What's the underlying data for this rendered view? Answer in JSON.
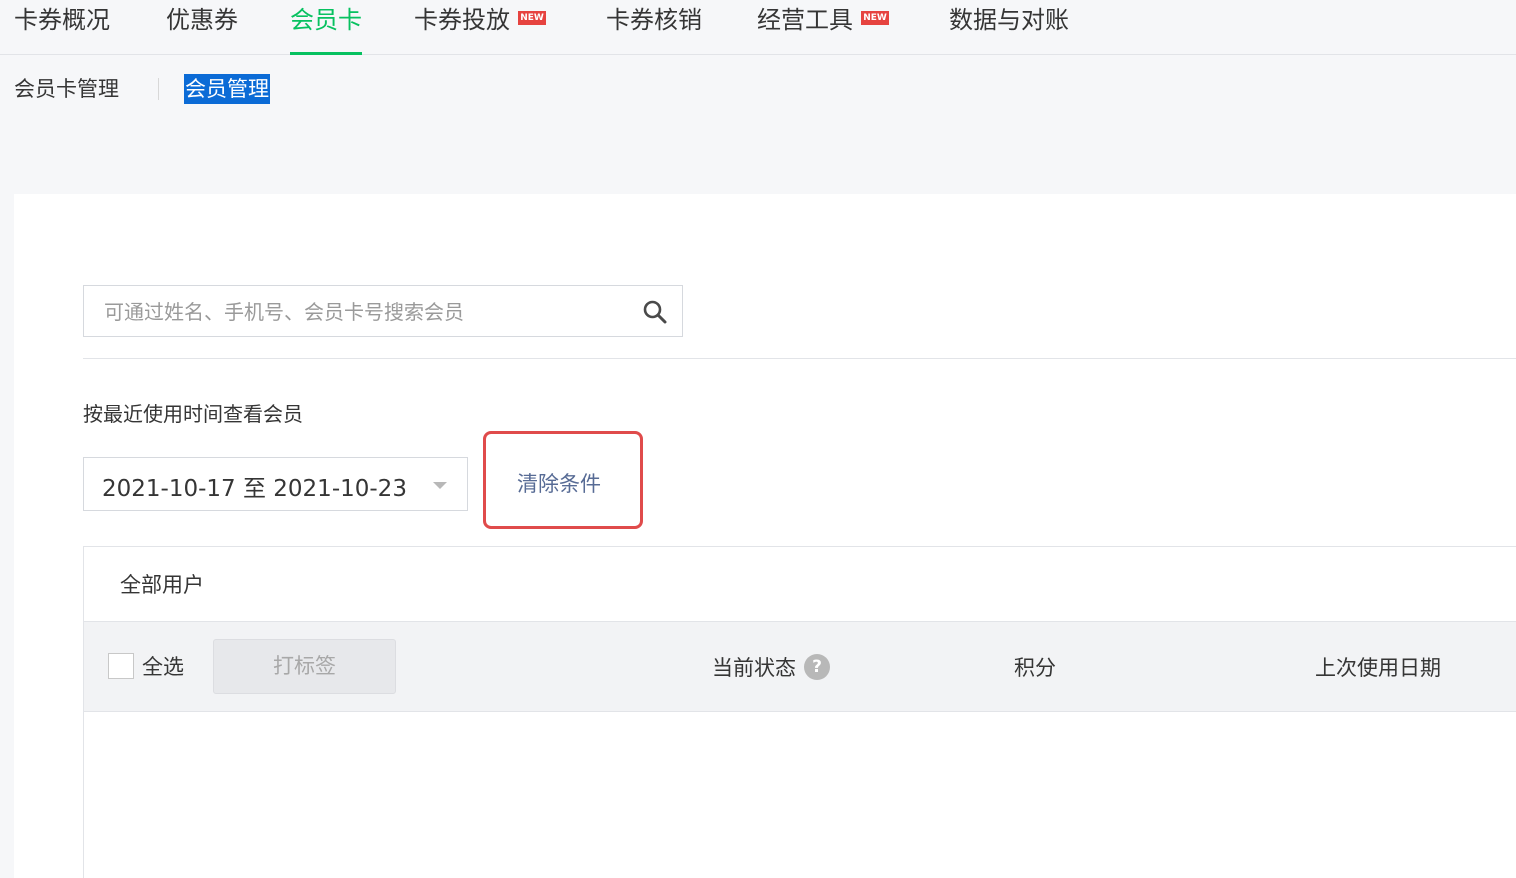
{
  "nav": {
    "items": [
      {
        "label": "卡券概况"
      },
      {
        "label": "优惠券"
      },
      {
        "label": "会员卡"
      },
      {
        "label": "卡券投放",
        "badge": "NEW"
      },
      {
        "label": "卡券核销"
      },
      {
        "label": "经营工具",
        "badge": "NEW"
      },
      {
        "label": "数据与对账"
      }
    ],
    "active_index": 2,
    "accent": "#07c160"
  },
  "subnav": {
    "items": [
      "会员卡管理",
      "会员管理"
    ],
    "selected": "会员管理"
  },
  "search": {
    "placeholder": "可通过姓名、手机号、会员卡号搜索会员",
    "value": ""
  },
  "filter": {
    "label": "按最近使用时间查看会员",
    "date_range": "2021-10-17 至 2021-10-23",
    "clear_label": "清除条件"
  },
  "table": {
    "tab_label": "全部用户",
    "select_all_label": "全选",
    "tag_button_label": "打标签",
    "columns": [
      "当前状态",
      "积分",
      "上次使用日期"
    ],
    "help_glyph": "?",
    "rows": []
  }
}
